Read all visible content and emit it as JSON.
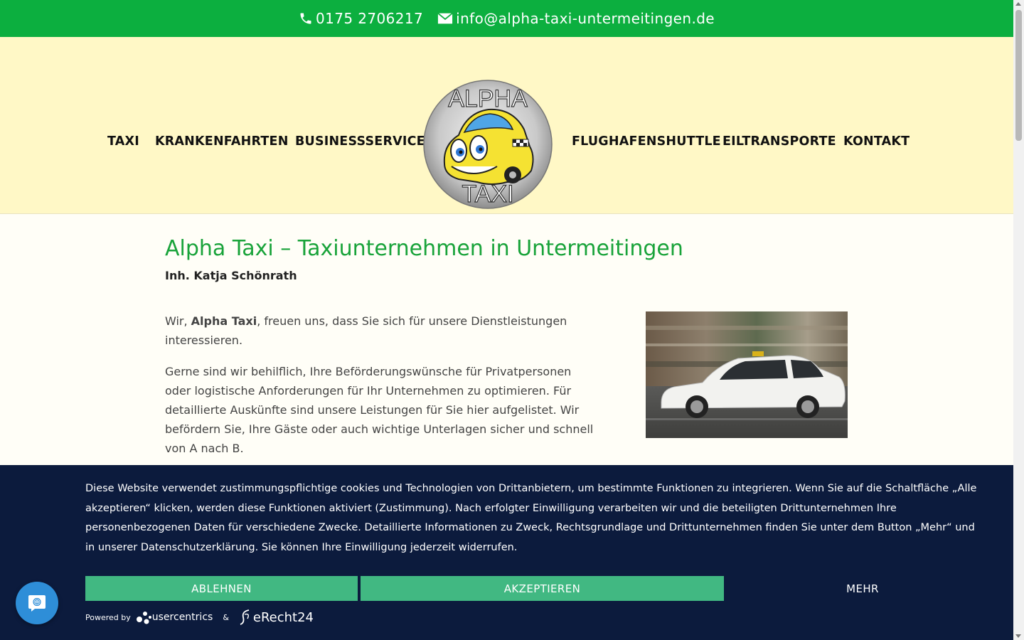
{
  "topbar": {
    "phone": "0175 2706217",
    "email": "info@alpha-taxi-untermeitingen.de",
    "icons": [
      "phone-icon",
      "mail-icon"
    ],
    "bg_color": "#0caf3f"
  },
  "nav": {
    "left": [
      "TAXI",
      "KRANKENFAHRTEN",
      "BUSINESSSERVICE"
    ],
    "right": [
      "FLUGHAFENSHUTTLE",
      "EILTRANSPORTE",
      "KONTAKT"
    ],
    "logo": {
      "top_text": "ALPHA",
      "bottom_text": "TAXI"
    }
  },
  "main": {
    "title": "Alpha Taxi – Taxiunternehmen in Untermeitingen",
    "subtitle": "Inh. Katja Schönrath",
    "p1_pre": "Wir, ",
    "p1_bold": "Alpha Taxi",
    "p1_post": ", freuen uns, dass Sie sich für unsere Dienstleistungen interessieren.",
    "p2": "Gerne sind wir behilflich, Ihre Beförderungswünsche für Privatpersonen oder logistische Anforderungen für Ihr Unternehmen zu optimieren. Für detaillierte Auskünfte sind unsere Leistungen für Sie hier aufgelistet. Wir befördern Sie, Ihre Gäste oder auch wichtige Unterlagen sicher und schnell von A nach B.",
    "accent_color": "#19a33a"
  },
  "cookie": {
    "text": "Diese Website verwendet zustimmungspflichtige cookies und Technologien von Drittanbietern, um bestimmte Funktionen zu integrieren. Wenn Sie auf die Schaltfläche „Alle akzeptieren“ klicken, werden diese Funktionen aktiviert (Zustimmung). Nach erfolgter Einwilligung verarbeiten wir und die beteiligten Drittunternehmen Ihre personenbezogenen Daten für verschiedene Zwecke. Detaillierte Informationen zu Zweck, Rechtsgrundlage und Drittunternehmen finden Sie unter dem Button „Mehr“ und in unserer Datenschutzerklärung. Sie können Ihre Einwilligung jederzeit widerrufen.",
    "deny": "ABLEHNEN",
    "accept": "AKZEPTIEREN",
    "more": "MEHR",
    "powered_by": "Powered by",
    "usercentrics": "usercentrics",
    "amp": "&",
    "erecht": "eRecht24",
    "bg_color": "#0c1b3d",
    "button_color": "#41b882"
  }
}
